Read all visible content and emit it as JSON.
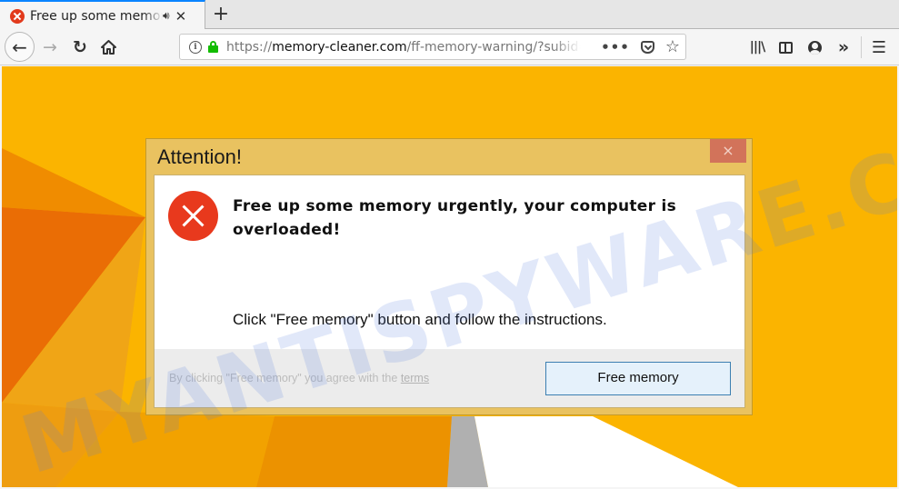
{
  "browser": {
    "tab": {
      "title": "Free up some memory urgently",
      "favicon": "error-x-icon",
      "audio_icon": "speaker-icon",
      "close_label": "✕"
    },
    "new_tab_label": "+",
    "nav": {
      "back_icon": "←",
      "forward_icon": "→",
      "reload_icon": "↻",
      "home_icon": "home-icon"
    },
    "url": {
      "scheme": "https://",
      "host": "memory-cleaner.com",
      "path": "/ff-memory-warning/?subid=",
      "secure": true,
      "lock_color": "#12bc00"
    },
    "url_actions": {
      "more": "•••",
      "pocket": "pocket-icon",
      "bookmark": "☆"
    },
    "toolbar": {
      "library": "|||\\",
      "sidebar": "sidebar-icon",
      "account": "account-icon",
      "overflow": "»",
      "menu": "☰"
    }
  },
  "dialog": {
    "title": "Attention!",
    "close_label": "×",
    "headline": "Free up some memory urgently, your computer is overloaded!",
    "instruction": "Click \"Free memory\" button and follow the instructions.",
    "terms_prefix": "By clicking \"Free memory\" you agree with the ",
    "terms_link": "terms",
    "button_label": "Free memory"
  },
  "colors": {
    "page_bg": "#fbb400",
    "dialog_frame": "#e9c260",
    "dialog_close": "#d2735a",
    "error_icon": "#e8391d",
    "button_bg": "#e5f1fb",
    "button_border": "#3c7fb1"
  },
  "watermark": "MYANTISPYWARE.COM"
}
